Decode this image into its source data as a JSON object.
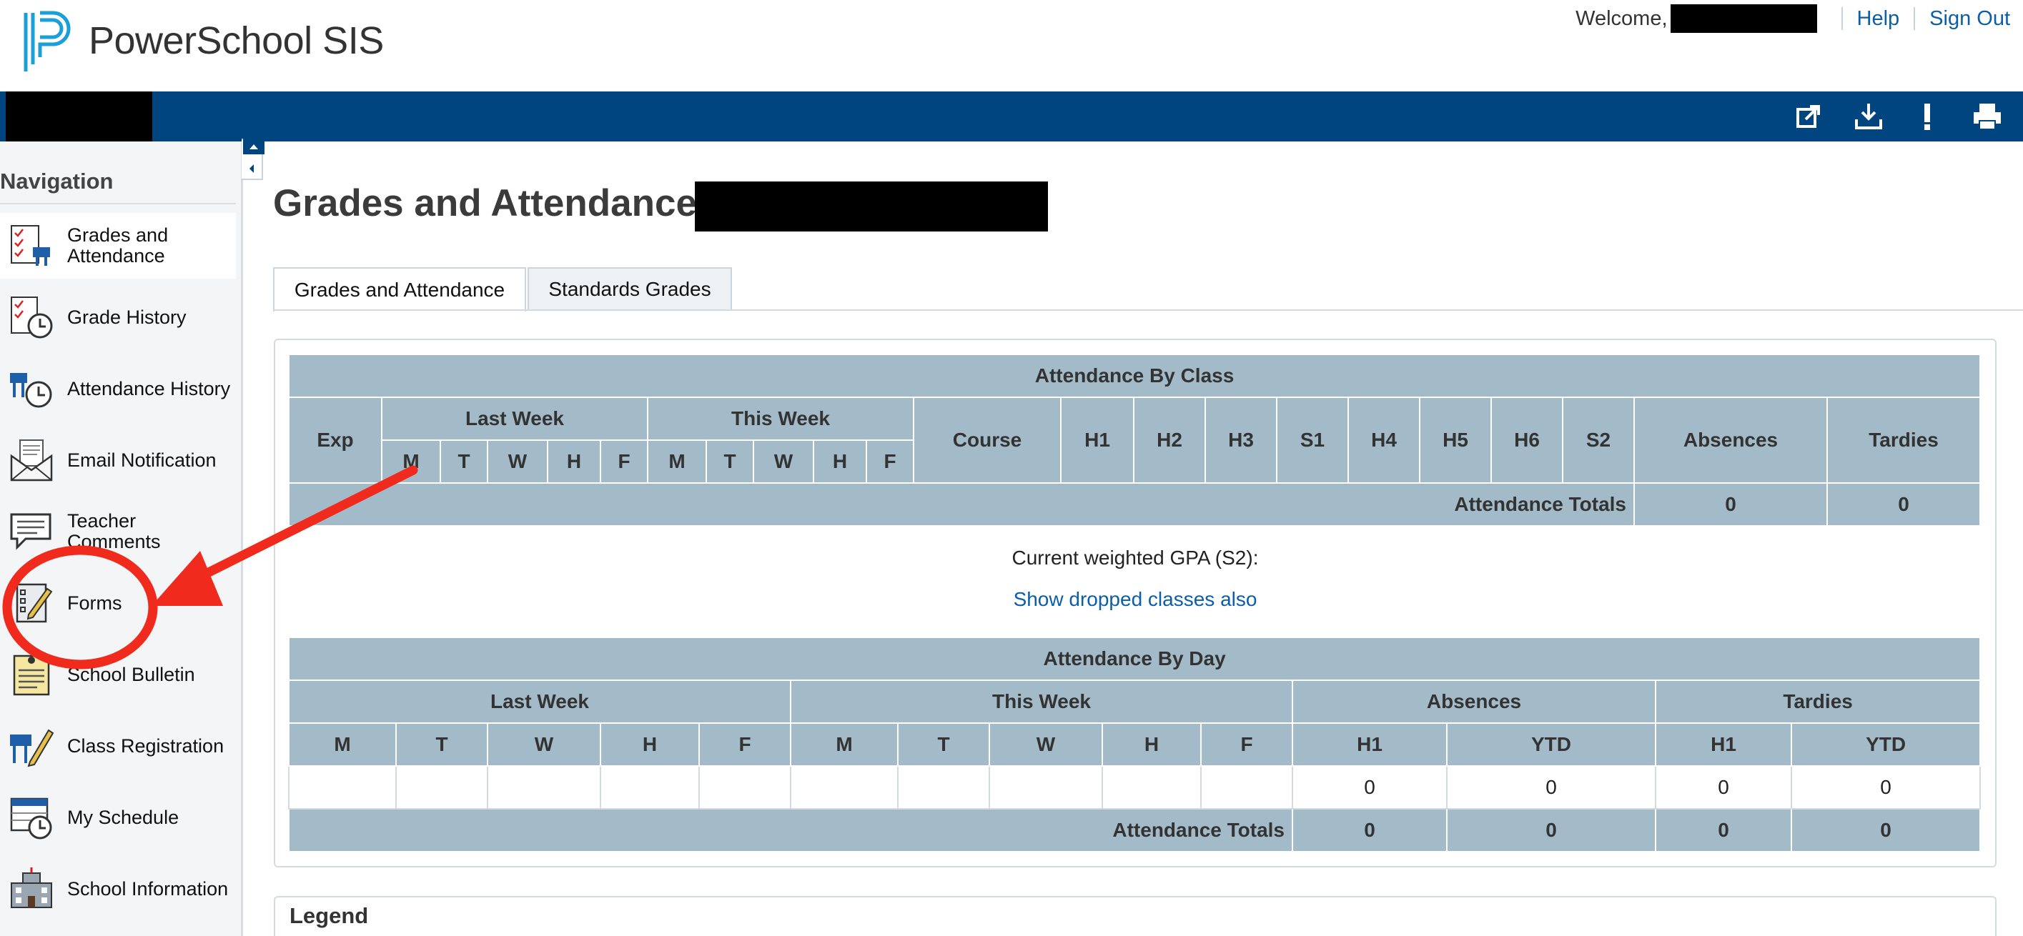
{
  "header": {
    "brand": "PowerSchool SIS",
    "welcome": "Welcome,",
    "help": "Help",
    "sign_out": "Sign Out"
  },
  "toolbar": {
    "icons": [
      "external-link-icon",
      "download-icon",
      "alert-icon",
      "print-icon"
    ]
  },
  "sidebar": {
    "title": "Navigation",
    "items": [
      {
        "label": "Grades and Attendance",
        "icon": "grades-icon"
      },
      {
        "label": "Grade History",
        "icon": "grade-history-icon"
      },
      {
        "label": "Attendance History",
        "icon": "attendance-history-icon"
      },
      {
        "label": "Email Notification",
        "icon": "email-icon"
      },
      {
        "label": "Teacher Comments",
        "icon": "comments-icon"
      },
      {
        "label": "Forms",
        "icon": "forms-icon"
      },
      {
        "label": "School Bulletin",
        "icon": "bulletin-icon"
      },
      {
        "label": "Class Registration",
        "icon": "registration-icon"
      },
      {
        "label": "My Schedule",
        "icon": "schedule-icon"
      },
      {
        "label": "School Information",
        "icon": "school-icon"
      }
    ]
  },
  "main": {
    "title": "Grades and Attendance:",
    "tabs": [
      {
        "label": "Grades and Attendance"
      },
      {
        "label": "Standards Grades"
      }
    ],
    "by_class": {
      "title": "Attendance By Class",
      "exp": "Exp",
      "last_week": "Last Week",
      "this_week": "This Week",
      "days": [
        "M",
        "T",
        "W",
        "H",
        "F"
      ],
      "course": "Course",
      "terms": [
        "H1",
        "H2",
        "H3",
        "S1",
        "H4",
        "H5",
        "H6",
        "S2"
      ],
      "absences": "Absences",
      "tardies": "Tardies",
      "totals_label": "Attendance Totals",
      "total_absences": "0",
      "total_tardies": "0"
    },
    "gpa_label": "Current weighted GPA (S2):",
    "dropped_link": "Show dropped classes also",
    "by_day": {
      "title": "Attendance By Day",
      "last_week": "Last Week",
      "this_week": "This Week",
      "absences": "Absences",
      "tardies": "Tardies",
      "days": [
        "M",
        "T",
        "W",
        "H",
        "F"
      ],
      "h1": "H1",
      "ytd": "YTD",
      "values": {
        "abs_h1": "0",
        "abs_ytd": "0",
        "tar_h1": "0",
        "tar_ytd": "0"
      },
      "totals_label": "Attendance Totals",
      "totals": {
        "abs_h1": "0",
        "abs_ytd": "0",
        "tar_h1": "0",
        "tar_ytd": "0"
      }
    },
    "legend": "Legend"
  },
  "colors": {
    "brand_blue": "#004480",
    "table_header": "#a3bbc8",
    "link": "#0b5ea8",
    "annotation_red": "#f02a1c"
  }
}
